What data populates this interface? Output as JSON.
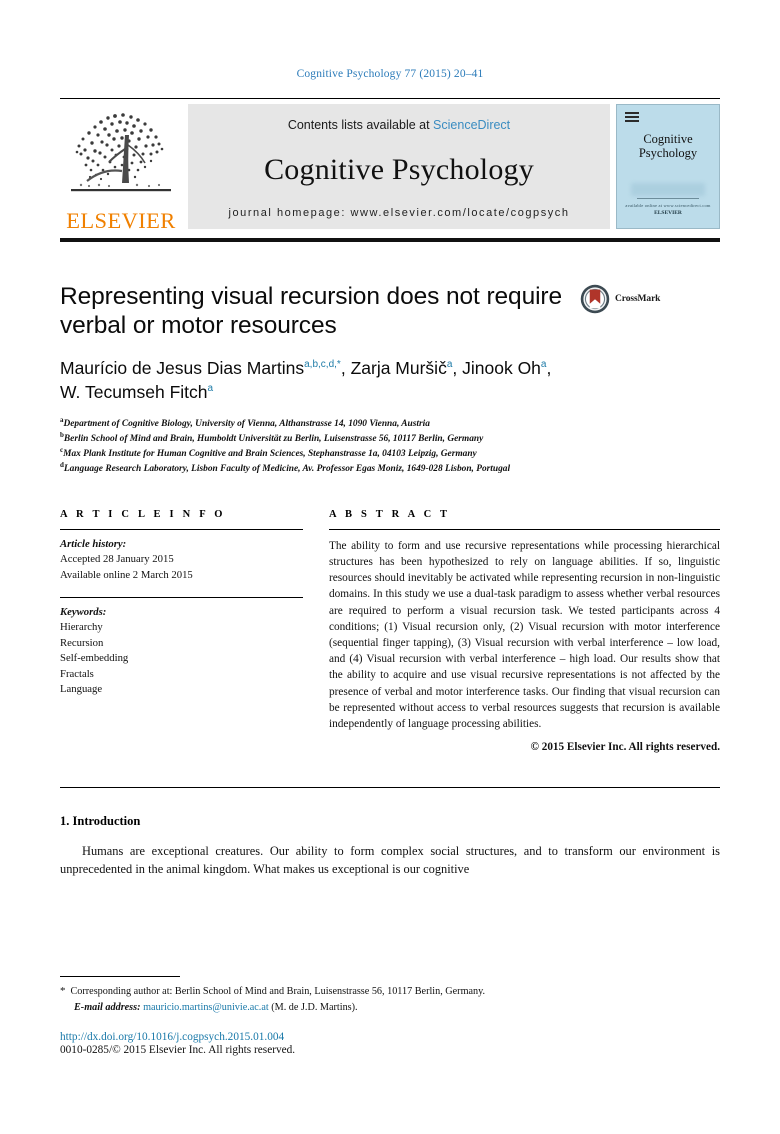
{
  "running_head": "Cognitive Psychology 77 (2015) 20–41",
  "masthead": {
    "publisher_name": "ELSEVIER",
    "contents_prefix": "Contents lists available at ",
    "contents_link": "ScienceDirect",
    "journal_title": "Cognitive Psychology",
    "homepage": "journal homepage: www.elsevier.com/locate/cogpsych",
    "cover": {
      "title_line1": "Cognitive",
      "title_line2": "Psychology",
      "footer_small": "ELSEVIER",
      "footer_tiny": "available online at www.sciencedirect.com"
    }
  },
  "article": {
    "title_line1": "Representing visual recursion does not require",
    "title_line2": "verbal or motor resources",
    "crossmark_label": "CrossMark",
    "authors": [
      {
        "name": "Maurício de Jesus Dias Martins",
        "marks": "a,b,c,d,*",
        "sep": ", "
      },
      {
        "name": "Zarja Muršič",
        "marks": "a",
        "sep": ", "
      },
      {
        "name": "Jinook Oh",
        "marks": "a",
        "sep": ","
      },
      {
        "name": "W. Tecumseh Fitch",
        "marks": "a",
        "sep": ""
      }
    ],
    "affiliations": [
      {
        "mark": "a",
        "text": "Department of Cognitive Biology, University of Vienna, Althanstrasse 14, 1090 Vienna, Austria"
      },
      {
        "mark": "b",
        "text": "Berlin School of Mind and Brain, Humboldt Universität zu Berlin, Luisenstrasse 56, 10117 Berlin, Germany"
      },
      {
        "mark": "c",
        "text": "Max Plank Institute for Human Cognitive and Brain Sciences, Stephanstrasse 1a, 04103 Leipzig, Germany"
      },
      {
        "mark": "d",
        "text": "Language Research Laboratory, Lisbon Faculty of Medicine, Av. Professor Egas Moniz, 1649-028 Lisbon, Portugal"
      }
    ]
  },
  "article_info": {
    "heading": "A R T I C L E   I N F O",
    "history_label": "Article history:",
    "history_lines": [
      "Accepted 28 January 2015",
      "Available online 2 March 2015"
    ],
    "keywords_label": "Keywords:",
    "keywords": [
      "Hierarchy",
      "Recursion",
      "Self-embedding",
      "Fractals",
      "Language"
    ]
  },
  "abstract": {
    "heading": "A B S T R A C T",
    "text": "The ability to form and use recursive representations while processing hierarchical structures has been hypothesized to rely on language abilities. If so, linguistic resources should inevitably be activated while representing recursion in non-linguistic domains. In this study we use a dual-task paradigm to assess whether verbal resources are required to perform a visual recursion task. We tested participants across 4 conditions; (1) Visual recursion only, (2) Visual recursion with motor interference (sequential finger tapping), (3) Visual recursion with verbal interference – low load, and (4) Visual recursion with verbal interference – high load. Our results show that the ability to acquire and use visual recursive representations is not affected by the presence of verbal and motor interference tasks. Our finding that visual recursion can be represented without access to verbal resources suggests that recursion is available independently of language processing abilities.",
    "copyright": "© 2015 Elsevier Inc. All rights reserved."
  },
  "body": {
    "section_number_title": "1. Introduction",
    "paragraph": "Humans are exceptional creatures. Our ability to form complex social structures, and to transform our environment is unprecedented in the animal kingdom. What makes us exceptional is our cognitive"
  },
  "footer": {
    "star": "*",
    "corresponding": "Corresponding author at: Berlin School of Mind and Brain, Luisenstrasse 56, 10117 Berlin, Germany.",
    "email_label": "E-mail address:",
    "email": "mauricio.martins@univie.ac.at",
    "email_suffix": "(M. de J.D. Martins).",
    "doi": "http://dx.doi.org/10.1016/j.cogpsych.2015.01.004",
    "issn": "0010-0285/© 2015 Elsevier Inc. All rights reserved."
  },
  "colors": {
    "link_blue": "#2b7bb9",
    "sciencedirect_blue": "#3a8cc1",
    "elsevier_orange": "#f08000",
    "superscript_teal": "#1f7ca8",
    "cover_blue": "#bcdcea",
    "crossmark_red": "#b0352a"
  }
}
